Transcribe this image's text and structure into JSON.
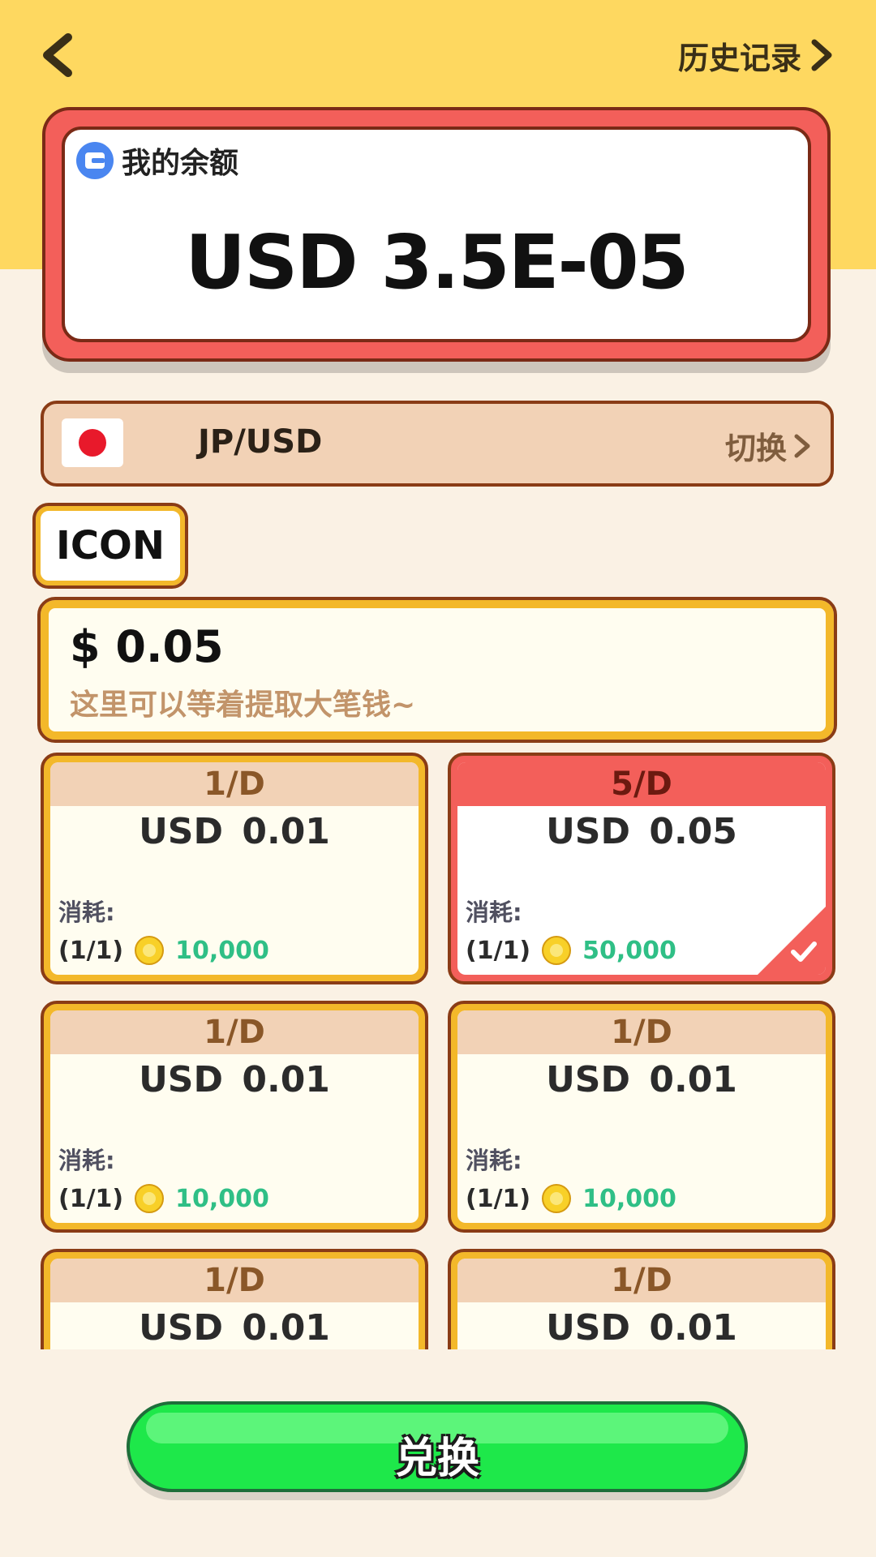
{
  "header": {
    "history_label": "历史记录"
  },
  "balance": {
    "label": "我的余额",
    "value": "USD 3.5E-05"
  },
  "currency": {
    "pair": "JP/USD",
    "switch_label": "切换",
    "flag": "japan-flag"
  },
  "tab": {
    "label": "ICON"
  },
  "promo": {
    "amount": "$ 0.05",
    "subtitle": "这里可以等着提取大笔钱~"
  },
  "options": [
    {
      "freq": "1/D",
      "currency": "USD",
      "amount": "0.01",
      "cost_label": "消耗:",
      "limit": "(1/1)",
      "cost": "10,000",
      "selected": false
    },
    {
      "freq": "5/D",
      "currency": "USD",
      "amount": "0.05",
      "cost_label": "消耗:",
      "limit": "(1/1)",
      "cost": "50,000",
      "selected": true
    },
    {
      "freq": "1/D",
      "currency": "USD",
      "amount": "0.01",
      "cost_label": "消耗:",
      "limit": "(1/1)",
      "cost": "10,000",
      "selected": false
    },
    {
      "freq": "1/D",
      "currency": "USD",
      "amount": "0.01",
      "cost_label": "消耗:",
      "limit": "(1/1)",
      "cost": "10,000",
      "selected": false
    },
    {
      "freq": "1/D",
      "currency": "USD",
      "amount": "0.01",
      "cost_label": "",
      "limit": "",
      "cost": "",
      "selected": false
    },
    {
      "freq": "1/D",
      "currency": "USD",
      "amount": "0.01",
      "cost_label": "",
      "limit": "",
      "cost": "",
      "selected": false
    }
  ],
  "exchange_button": {
    "label": "兑换"
  },
  "colors": {
    "top_band": "#fed860",
    "background": "#faf1e4",
    "accent_red": "#f35f5a",
    "gold_border": "#f3b82a",
    "cost_green": "#2fbf86",
    "button_green": "#1ee84a"
  }
}
